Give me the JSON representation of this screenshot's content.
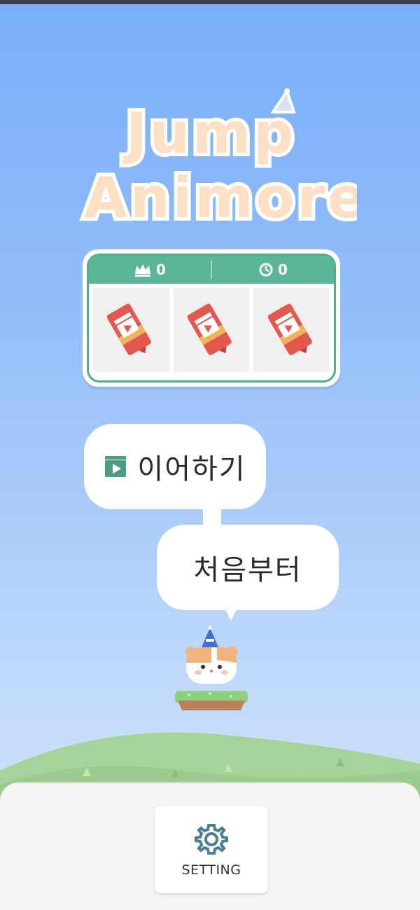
{
  "logo": {
    "line1": "Jump",
    "line2": "Animore!"
  },
  "score": {
    "best": "0",
    "time": "0"
  },
  "slots": [
    {
      "icon": "video-ticket-icon"
    },
    {
      "icon": "video-ticket-icon"
    },
    {
      "icon": "video-ticket-icon"
    }
  ],
  "menu": {
    "continue_label": "이어하기",
    "restart_label": "처음부터"
  },
  "settings": {
    "label": "SETTING"
  },
  "colors": {
    "accent_green": "#5cb597",
    "sky_top": "#79aef9",
    "sky_bottom": "#d2e3fb",
    "hill_green": "#a7d39a",
    "ticket_red": "#e4574f",
    "logo_fill": "#fbe0c6"
  }
}
